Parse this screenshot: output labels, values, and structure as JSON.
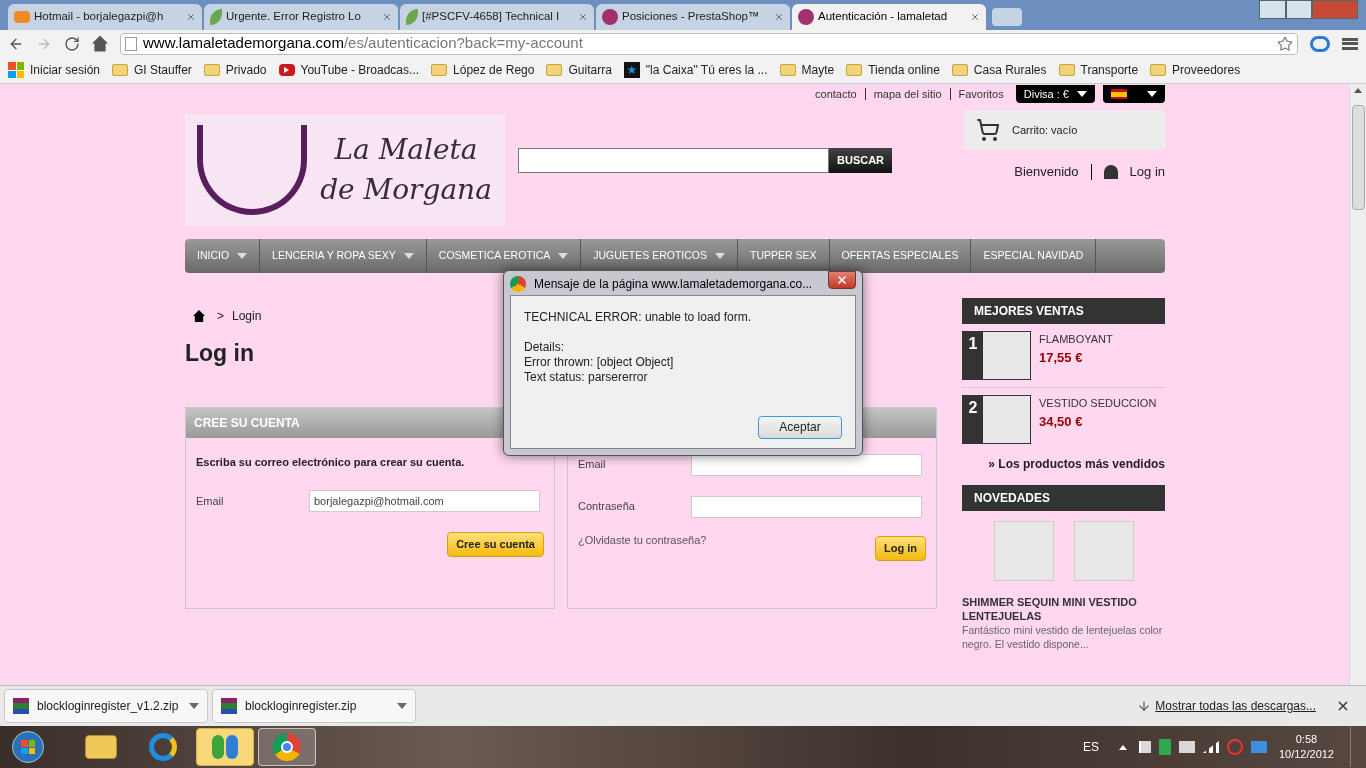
{
  "browser": {
    "tabs": [
      {
        "title": "Hotmail - borjalegazpi@h",
        "kind": "mail",
        "selected": false
      },
      {
        "title": "Urgente. Error Registro Lo",
        "kind": "tracker",
        "selected": false
      },
      {
        "title": "[#PSCFV-4658] Technical I",
        "kind": "tracker",
        "selected": false
      },
      {
        "title": "Posiciones - PrestaShop™",
        "kind": "shop",
        "selected": false
      },
      {
        "title": "Autenticación - lamaletad",
        "kind": "shop",
        "selected": true
      }
    ],
    "url_host": "www.lamaletademorgana.com",
    "url_path": "/es/autenticacion?back=my-account",
    "bookmarks": [
      {
        "label": "Iniciar sesión",
        "kind": "windows"
      },
      {
        "label": "GI Stauffer",
        "kind": "folder"
      },
      {
        "label": "Privado",
        "kind": "folder"
      },
      {
        "label": "YouTube - Broadcas...",
        "kind": "video"
      },
      {
        "label": "López de Rego",
        "kind": "folder"
      },
      {
        "label": "Guitarra",
        "kind": "folder"
      },
      {
        "label": "\"la Caixa\" Tú eres la ...",
        "kind": "bank"
      },
      {
        "label": "Mayte",
        "kind": "folder"
      },
      {
        "label": "Tienda online",
        "kind": "folder"
      },
      {
        "label": "Casa Rurales",
        "kind": "folder"
      },
      {
        "label": "Transporte",
        "kind": "folder"
      },
      {
        "label": "Proveedores",
        "kind": "folder"
      }
    ]
  },
  "site": {
    "top_links": [
      "contacto",
      "mapa del sitio",
      "Favoritos"
    ],
    "currency": "Divisa : €",
    "logo": "La Maleta de Morgana",
    "search_button": "BUSCAR",
    "cart": "Carrito: vacío",
    "welcome": "Bienvenido",
    "login_link": "Log in",
    "menu": [
      {
        "label": "INICIO",
        "has_submenu": true
      },
      {
        "label": "LENCERIA Y ROPA SEXY",
        "has_submenu": true
      },
      {
        "label": "COSMETICA EROTICA",
        "has_submenu": true
      },
      {
        "label": "JUGUETES EROTICOS",
        "has_submenu": true
      },
      {
        "label": "TUPPER SEX",
        "has_submenu": false
      },
      {
        "label": "OFERTAS ESPECIALES",
        "has_submenu": false
      },
      {
        "label": "ESPECIAL NAVIDAD",
        "has_submenu": false
      }
    ],
    "breadcrumb": {
      "separator": ">",
      "current": "Login"
    },
    "heading": "Log in",
    "create": {
      "title": "CREE SU CUENTA",
      "intro": "Escriba su correo electrónico para crear su cuenta.",
      "email_label": "Email",
      "email_value": "borjalegazpi@hotmail.com",
      "button": "Cree su cuenta"
    },
    "login": {
      "email_label": "Email",
      "password_label": "Contraseña",
      "forgot": "¿Olvidaste tu contraseña?",
      "button": "Log in"
    },
    "best_sellers": {
      "title": "MEJORES VENTAS",
      "items": [
        {
          "rank": "1",
          "name": "FLAMBOYANT",
          "price": "17,55 €"
        },
        {
          "rank": "2",
          "name": "VESTIDO SEDUCCION",
          "price": "34,50 €"
        }
      ],
      "more": "» Los productos más vendidos"
    },
    "news": {
      "title": "NOVEDADES",
      "product": "SHIMMER SEQUIN MINI VESTIDO LENTEJUELAS",
      "description": "Fantástico mini vestido de lentejuelas color negro. El vestido dispone..."
    }
  },
  "dialog": {
    "title": "Mensaje de la página www.lamaletademorgana.co...",
    "message": "TECHNICAL ERROR: unable to load form.",
    "details": [
      "Details:",
      "Error thrown: [object Object]",
      "Text status: parsererror"
    ],
    "button": "Aceptar"
  },
  "downloads": {
    "files": [
      "blockloginregister_v1.2.zip",
      "blockloginregister.zip"
    ],
    "show_all": "Mostrar todas las descargas..."
  },
  "taskbar": {
    "apps": [
      {
        "kind": "explorer",
        "highlighted": false,
        "open": false
      },
      {
        "kind": "ie",
        "highlighted": false,
        "open": false
      },
      {
        "kind": "messenger",
        "highlighted": true,
        "open": false
      },
      {
        "kind": "chrome",
        "highlighted": false,
        "open": true
      }
    ],
    "language": "ES",
    "time": "0:58",
    "date": "10/12/2012"
  }
}
